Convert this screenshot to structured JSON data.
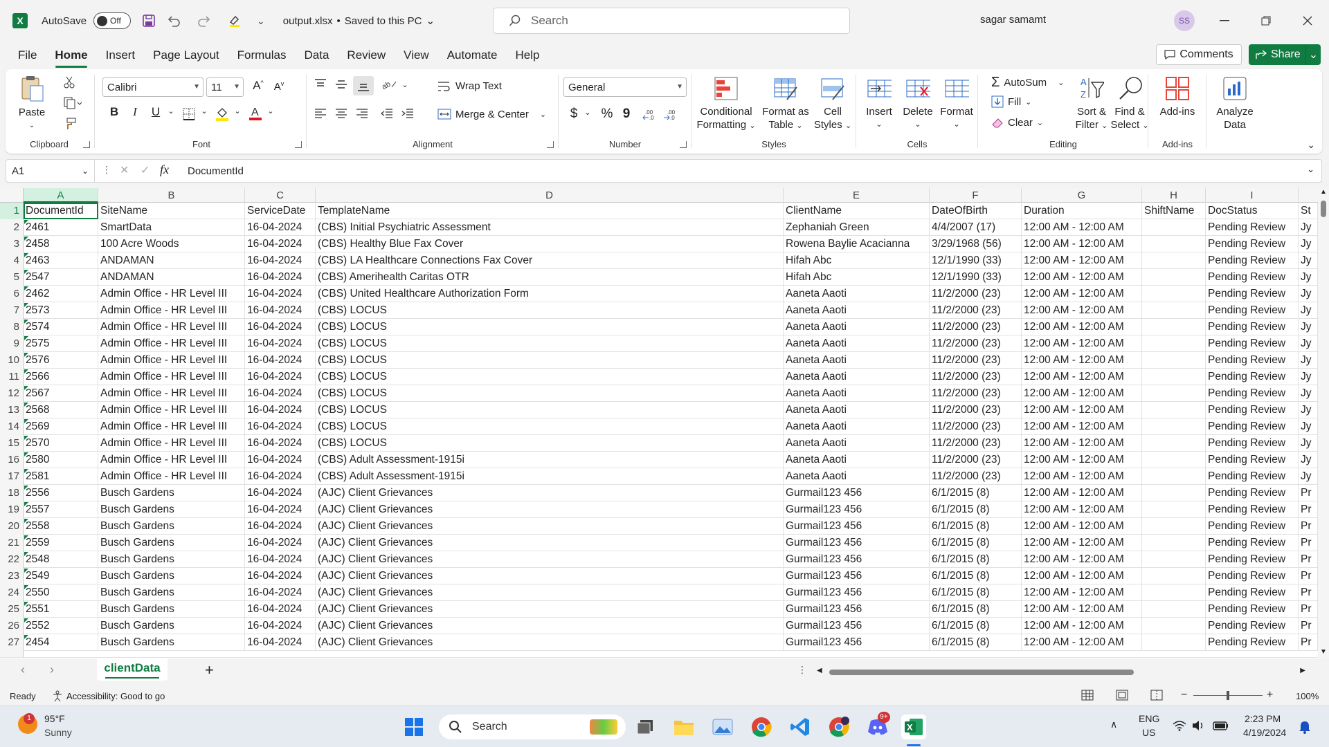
{
  "titlebar": {
    "autosave_label": "AutoSave",
    "autosave_state": "Off",
    "file_name": "output.xlsx",
    "save_status": "Saved to this PC",
    "search_placeholder": "Search",
    "user_name": "sagar samamt",
    "user_initials": "SS"
  },
  "menu": {
    "tabs": [
      "File",
      "Home",
      "Insert",
      "Page Layout",
      "Formulas",
      "Data",
      "Review",
      "View",
      "Automate",
      "Help"
    ],
    "comments_label": "Comments",
    "share_label": "Share"
  },
  "ribbon": {
    "clipboard": {
      "paste": "Paste",
      "label": "Clipboard"
    },
    "font": {
      "name": "Calibri",
      "size": "11",
      "label": "Font",
      "bold": "B",
      "italic": "I",
      "underline": "U"
    },
    "alignment": {
      "wrap_text": "Wrap Text",
      "merge_center": "Merge & Center",
      "label": "Alignment"
    },
    "number": {
      "format": "General",
      "label": "Number",
      "currency": "$",
      "percent": "%",
      "comma": "9"
    },
    "styles": {
      "conditional_1": "Conditional",
      "conditional_2": "Formatting",
      "format_table_1": "Format as",
      "format_table_2": "Table",
      "cell_styles_1": "Cell",
      "cell_styles_2": "Styles",
      "label": "Styles"
    },
    "cells": {
      "insert": "Insert",
      "delete": "Delete",
      "format": "Format",
      "label": "Cells"
    },
    "editing": {
      "autosum": "AutoSum",
      "fill": "Fill",
      "clear": "Clear",
      "sort_1": "Sort &",
      "sort_2": "Filter",
      "find_1": "Find &",
      "find_2": "Select",
      "label": "Editing"
    },
    "addins": {
      "addins": "Add-ins",
      "label": "Add-ins"
    },
    "analyze": {
      "line1": "Analyze",
      "line2": "Data"
    }
  },
  "formula_bar": {
    "name_box": "A1",
    "fx": "fx",
    "content": "DocumentId"
  },
  "columns": [
    "A",
    "B",
    "C",
    "D",
    "E",
    "F",
    "G",
    "H",
    "I"
  ],
  "rows": [
    {
      "n": "1",
      "c": [
        "DocumentId",
        "SiteName",
        "ServiceDate",
        "TemplateName",
        "ClientName",
        "DateOfBirth",
        "Duration",
        "ShiftName",
        "DocStatus",
        "St"
      ]
    },
    {
      "n": "2",
      "c": [
        "2461",
        "SmartData",
        "16-04-2024",
        "(CBS) Initial Psychiatric Assessment",
        "Zephaniah  Green",
        "4/4/2007 (17)",
        "12:00 AM - 12:00 AM",
        "",
        "Pending Review",
        "Jy"
      ]
    },
    {
      "n": "3",
      "c": [
        "2458",
        "100 Acre Woods",
        "16-04-2024",
        "(CBS) Healthy Blue Fax Cover",
        "Rowena Baylie Acacianna",
        "3/29/1968 (56)",
        "12:00 AM - 12:00 AM",
        "",
        "Pending Review",
        "Jy"
      ]
    },
    {
      "n": "4",
      "c": [
        "2463",
        "ANDAMAN",
        "16-04-2024",
        "(CBS) LA Healthcare Connections Fax Cover",
        "Hifah  Abc",
        "12/1/1990 (33)",
        "12:00 AM - 12:00 AM",
        "",
        "Pending Review",
        "Jy"
      ]
    },
    {
      "n": "5",
      "c": [
        "2547",
        "ANDAMAN",
        "16-04-2024",
        "(CBS) Amerihealth Caritas OTR",
        "Hifah  Abc",
        "12/1/1990 (33)",
        "12:00 AM - 12:00 AM",
        "",
        "Pending Review",
        "Jy"
      ]
    },
    {
      "n": "6",
      "c": [
        "2462",
        "Admin Office - HR Level III",
        "16-04-2024",
        "(CBS) United Healthcare Authorization Form",
        "Aaneta  Aaoti",
        "11/2/2000 (23)",
        "12:00 AM - 12:00 AM",
        "",
        "Pending Review",
        "Jy"
      ]
    },
    {
      "n": "7",
      "c": [
        "2573",
        "Admin Office - HR Level III",
        "16-04-2024",
        "(CBS) LOCUS",
        "Aaneta  Aaoti",
        "11/2/2000 (23)",
        "12:00 AM - 12:00 AM",
        "",
        "Pending Review",
        "Jy"
      ]
    },
    {
      "n": "8",
      "c": [
        "2574",
        "Admin Office - HR Level III",
        "16-04-2024",
        "(CBS) LOCUS",
        "Aaneta  Aaoti",
        "11/2/2000 (23)",
        "12:00 AM - 12:00 AM",
        "",
        "Pending Review",
        "Jy"
      ]
    },
    {
      "n": "9",
      "c": [
        "2575",
        "Admin Office - HR Level III",
        "16-04-2024",
        "(CBS) LOCUS",
        "Aaneta  Aaoti",
        "11/2/2000 (23)",
        "12:00 AM - 12:00 AM",
        "",
        "Pending Review",
        "Jy"
      ]
    },
    {
      "n": "10",
      "c": [
        "2576",
        "Admin Office - HR Level III",
        "16-04-2024",
        "(CBS) LOCUS",
        "Aaneta  Aaoti",
        "11/2/2000 (23)",
        "12:00 AM - 12:00 AM",
        "",
        "Pending Review",
        "Jy"
      ]
    },
    {
      "n": "11",
      "c": [
        "2566",
        "Admin Office - HR Level III",
        "16-04-2024",
        "(CBS) LOCUS",
        "Aaneta  Aaoti",
        "11/2/2000 (23)",
        "12:00 AM - 12:00 AM",
        "",
        "Pending Review",
        "Jy"
      ]
    },
    {
      "n": "12",
      "c": [
        "2567",
        "Admin Office - HR Level III",
        "16-04-2024",
        "(CBS) LOCUS",
        "Aaneta  Aaoti",
        "11/2/2000 (23)",
        "12:00 AM - 12:00 AM",
        "",
        "Pending Review",
        "Jy"
      ]
    },
    {
      "n": "13",
      "c": [
        "2568",
        "Admin Office - HR Level III",
        "16-04-2024",
        "(CBS) LOCUS",
        "Aaneta  Aaoti",
        "11/2/2000 (23)",
        "12:00 AM - 12:00 AM",
        "",
        "Pending Review",
        "Jy"
      ]
    },
    {
      "n": "14",
      "c": [
        "2569",
        "Admin Office - HR Level III",
        "16-04-2024",
        "(CBS) LOCUS",
        "Aaneta  Aaoti",
        "11/2/2000 (23)",
        "12:00 AM - 12:00 AM",
        "",
        "Pending Review",
        "Jy"
      ]
    },
    {
      "n": "15",
      "c": [
        "2570",
        "Admin Office - HR Level III",
        "16-04-2024",
        "(CBS) LOCUS",
        "Aaneta  Aaoti",
        "11/2/2000 (23)",
        "12:00 AM - 12:00 AM",
        "",
        "Pending Review",
        "Jy"
      ]
    },
    {
      "n": "16",
      "c": [
        "2580",
        "Admin Office - HR Level III",
        "16-04-2024",
        "(CBS) Adult Assessment-1915i",
        "Aaneta  Aaoti",
        "11/2/2000 (23)",
        "12:00 AM - 12:00 AM",
        "",
        "Pending Review",
        "Jy"
      ]
    },
    {
      "n": "17",
      "c": [
        "2581",
        "Admin Office - HR Level III",
        "16-04-2024",
        "(CBS) Adult Assessment-1915i",
        "Aaneta  Aaoti",
        "11/2/2000 (23)",
        "12:00 AM - 12:00 AM",
        "",
        "Pending Review",
        "Jy"
      ]
    },
    {
      "n": "18",
      "c": [
        "2556",
        "Busch Gardens",
        "16-04-2024",
        "(AJC) Client Grievances",
        "Gurmail123  456",
        "6/1/2015 (8)",
        "12:00 AM - 12:00 AM",
        "",
        "Pending Review",
        "Pr"
      ]
    },
    {
      "n": "19",
      "c": [
        "2557",
        "Busch Gardens",
        "16-04-2024",
        "(AJC) Client Grievances",
        "Gurmail123  456",
        "6/1/2015 (8)",
        "12:00 AM - 12:00 AM",
        "",
        "Pending Review",
        "Pr"
      ]
    },
    {
      "n": "20",
      "c": [
        "2558",
        "Busch Gardens",
        "16-04-2024",
        "(AJC) Client Grievances",
        "Gurmail123  456",
        "6/1/2015 (8)",
        "12:00 AM - 12:00 AM",
        "",
        "Pending Review",
        "Pr"
      ]
    },
    {
      "n": "21",
      "c": [
        "2559",
        "Busch Gardens",
        "16-04-2024",
        "(AJC) Client Grievances",
        "Gurmail123  456",
        "6/1/2015 (8)",
        "12:00 AM - 12:00 AM",
        "",
        "Pending Review",
        "Pr"
      ]
    },
    {
      "n": "22",
      "c": [
        "2548",
        "Busch Gardens",
        "16-04-2024",
        "(AJC) Client Grievances",
        "Gurmail123  456",
        "6/1/2015 (8)",
        "12:00 AM - 12:00 AM",
        "",
        "Pending Review",
        "Pr"
      ]
    },
    {
      "n": "23",
      "c": [
        "2549",
        "Busch Gardens",
        "16-04-2024",
        "(AJC) Client Grievances",
        "Gurmail123  456",
        "6/1/2015 (8)",
        "12:00 AM - 12:00 AM",
        "",
        "Pending Review",
        "Pr"
      ]
    },
    {
      "n": "24",
      "c": [
        "2550",
        "Busch Gardens",
        "16-04-2024",
        "(AJC) Client Grievances",
        "Gurmail123  456",
        "6/1/2015 (8)",
        "12:00 AM - 12:00 AM",
        "",
        "Pending Review",
        "Pr"
      ]
    },
    {
      "n": "25",
      "c": [
        "2551",
        "Busch Gardens",
        "16-04-2024",
        "(AJC) Client Grievances",
        "Gurmail123  456",
        "6/1/2015 (8)",
        "12:00 AM - 12:00 AM",
        "",
        "Pending Review",
        "Pr"
      ]
    },
    {
      "n": "26",
      "c": [
        "2552",
        "Busch Gardens",
        "16-04-2024",
        "(AJC) Client Grievances",
        "Gurmail123  456",
        "6/1/2015 (8)",
        "12:00 AM - 12:00 AM",
        "",
        "Pending Review",
        "Pr"
      ]
    },
    {
      "n": "27",
      "c": [
        "2454",
        "Busch Gardens",
        "16-04-2024",
        "(AJC) Client Grievances",
        "Gurmail123  456",
        "6/1/2015 (8)",
        "12:00 AM - 12:00 AM",
        "",
        "Pending Review",
        "Pr"
      ]
    }
  ],
  "sheet": {
    "tab_name": "clientData",
    "add_sheet": "+"
  },
  "status": {
    "ready": "Ready",
    "accessibility": "Accessibility: Good to go",
    "zoom": "100%"
  },
  "taskbar": {
    "weather_temp": "95°F",
    "weather_desc": "Sunny",
    "weather_badge": "1",
    "search_label": "Search",
    "language_1": "ENG",
    "language_2": "US",
    "time": "2:23 PM",
    "date": "4/19/2024",
    "discord_badge": "9+"
  },
  "colors": {
    "excel_green": "#107c41",
    "selection_fill": "#d3f0e0"
  }
}
